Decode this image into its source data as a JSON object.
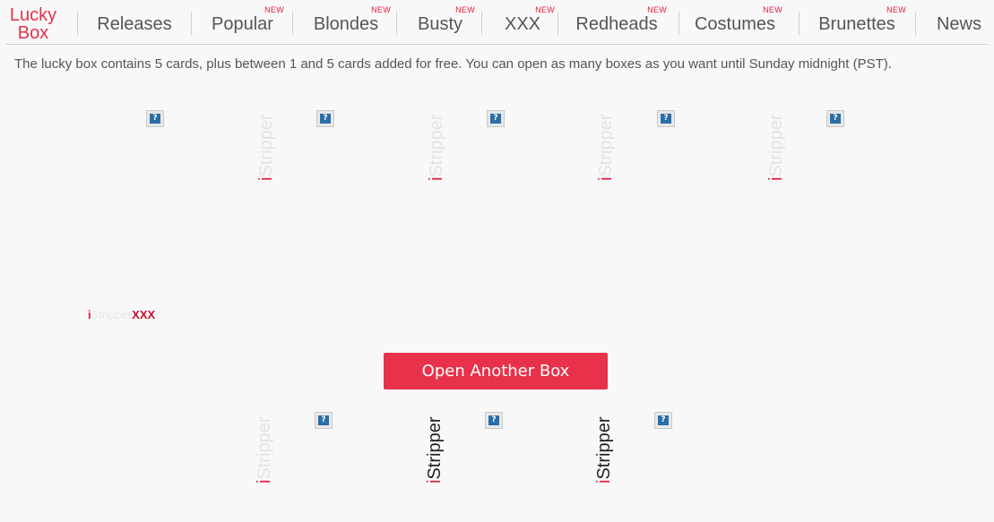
{
  "nav": {
    "lucky": {
      "line1": "Lucky",
      "line2": "Box"
    },
    "items": [
      {
        "label": "Releases",
        "new": ""
      },
      {
        "label": "Popular",
        "new": "NEW"
      },
      {
        "label": "Blondes",
        "new": "NEW"
      },
      {
        "label": "Busty",
        "new": "NEW"
      },
      {
        "label": "XXX",
        "new": "NEW"
      },
      {
        "label": "Redheads",
        "new": "NEW"
      },
      {
        "label": "Costumes",
        "new": "NEW"
      },
      {
        "label": "Brunettes",
        "new": "NEW"
      },
      {
        "label": "News",
        "new": ""
      }
    ]
  },
  "info_text": "The lucky box contains 5 cards, plus between 1 and 5 cards added for free. You can open as many boxes as you want until Sunday midnight (PST).",
  "icons": {
    "help": "?"
  },
  "logo": {
    "i": "i",
    "stripper": "Stripper",
    "xxx": "XXX"
  },
  "open_button": "Open Another Box",
  "colors": {
    "accent": "#e8314a",
    "new_badge": "#e31c3d",
    "help_icon": "#2a6ea8",
    "background": "#f8f8f8"
  }
}
